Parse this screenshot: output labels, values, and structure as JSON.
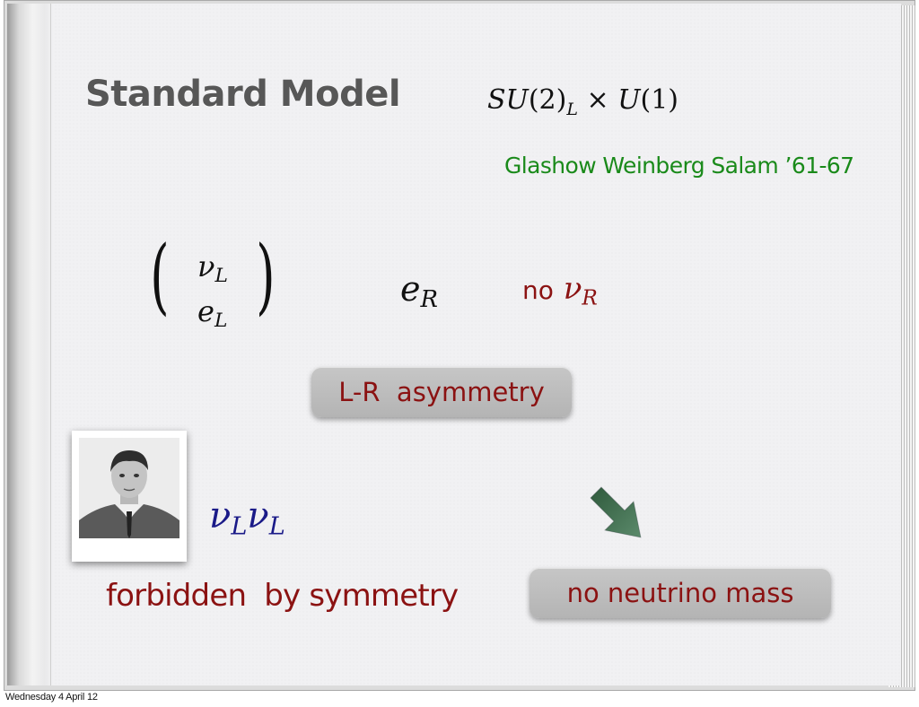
{
  "slide": {
    "title": "Standard Model",
    "gauge_group": {
      "su": "SU",
      "su_arg": "(2)",
      "su_sub": "L",
      "times": " × ",
      "u": "U",
      "u_arg": "(1)"
    },
    "authors": "Glashow Weinberg Salam ’61-67",
    "doublet": {
      "top": "ν",
      "top_sub": "L",
      "bottom": "e",
      "bottom_sub": "L",
      "left_paren": "(",
      "right_paren": ")"
    },
    "singlet": {
      "symbol": "e",
      "sub": "R"
    },
    "no_right_neutrino": {
      "word": "no",
      "symbol": "ν",
      "sub": "R"
    },
    "asymmetry_box": "L-R  asymmetry",
    "majorana_term": {
      "a": "ν",
      "a_sub": "L",
      "b": "ν",
      "b_sub": "L"
    },
    "forbidden_text": "forbidden  by symmetry",
    "mass_box": "no neutrino mass"
  },
  "footer": {
    "date": "Wednesday 4 April 12"
  },
  "colors": {
    "title": "#575757",
    "authors": "#1a8a1a",
    "highlight_red": "#8b1212",
    "majorana_blue": "#1a1a88",
    "pill_bg": "#bdbdbd",
    "arrow": "#3d6b4d"
  },
  "icons": {
    "arrow": "arrow-down-right-icon",
    "photo": "portrait-photo"
  }
}
